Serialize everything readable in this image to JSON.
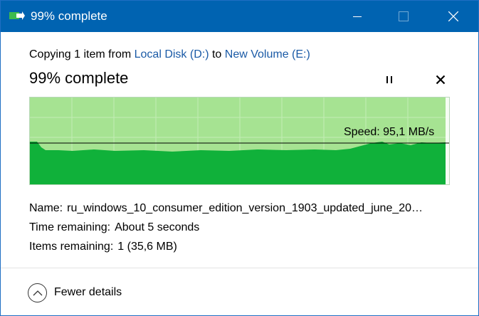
{
  "window": {
    "title": "99% complete",
    "icons": {
      "app": "copy-arrow-icon",
      "minimize": "minimize-icon",
      "maximize": "maximize-icon",
      "close": "close-icon"
    }
  },
  "operation": {
    "prefix": "Copying 1 item from",
    "source": "Local Disk (D:)",
    "connector": "to",
    "destination": "New Volume (E:)"
  },
  "progress": {
    "label": "99% complete",
    "percent": 99,
    "pause_icon": "pause-icon",
    "cancel_icon": "cancel-icon"
  },
  "speed": {
    "label": "Speed: 95,1 MB/s"
  },
  "details": {
    "name_label": "Name:",
    "name_value": "ru_windows_10_consumer_edition_version_1903_updated_june_20…",
    "time_label": "Time remaining:",
    "time_value": "About 5 seconds",
    "items_label": "Items remaining:",
    "items_value": "1 (35,6 MB)"
  },
  "footer": {
    "toggle_label": "Fewer details",
    "toggle_icon": "chevron-up-icon"
  },
  "colors": {
    "titlebar": "#0063b1",
    "graph_bg": "#9fe08a",
    "graph_fill": "#10b13a",
    "link": "#1a5aa6"
  }
}
